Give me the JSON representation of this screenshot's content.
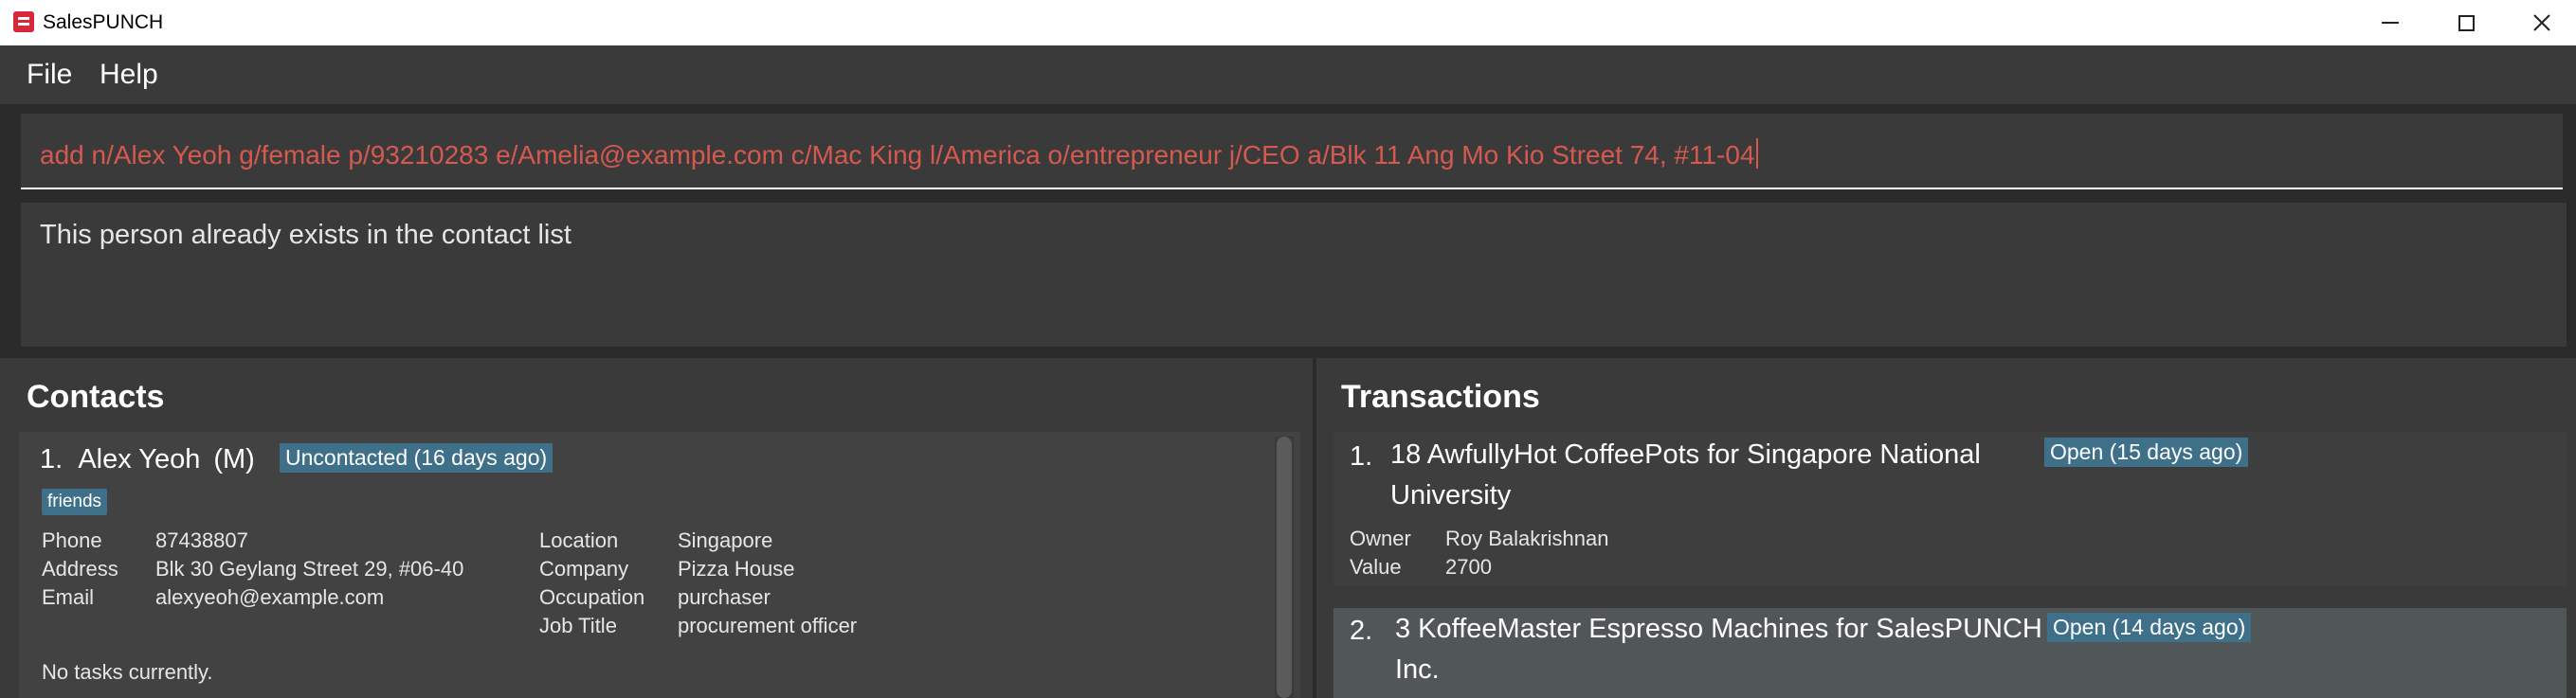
{
  "window": {
    "title": "SalesPUNCH",
    "controls": [
      "minimize",
      "maximize",
      "close"
    ]
  },
  "menu": {
    "file": "File",
    "help": "Help"
  },
  "command": {
    "value": "add n/Alex Yeoh g/female p/93210283 e/Amelia@example.com c/Mac King l/America o/entrepreneur j/CEO a/Blk 11 Ang Mo Kio Street 74, #11-04"
  },
  "result": {
    "message": "This person already exists in the contact list"
  },
  "contacts": {
    "title": "Contacts",
    "items": [
      {
        "index": "1.",
        "name": "Alex Yeoh",
        "gender": "(M)",
        "status": "Uncontacted (16 days ago)",
        "tag": "friends",
        "left_fields": [
          {
            "label": "Phone",
            "value": "87438807"
          },
          {
            "label": "Address",
            "value": "Blk 30 Geylang Street 29, #06-40"
          },
          {
            "label": "Email",
            "value": "alexyeoh@example.com"
          }
        ],
        "right_fields": [
          {
            "label": "Location",
            "value": "Singapore"
          },
          {
            "label": "Company",
            "value": "Pizza House"
          },
          {
            "label": "Occupation",
            "value": "purchaser"
          },
          {
            "label": "Job Title",
            "value": "procurement officer"
          }
        ],
        "tasks": "No tasks currently."
      }
    ]
  },
  "transactions": {
    "title": "Transactions",
    "items": [
      {
        "index": "1.",
        "title_line1": "18 AwfullyHot CoffeePots for Singapore National",
        "title_line2": "University",
        "status": "Open (15 days ago)",
        "owner_label": "Owner",
        "owner": "Roy Balakrishnan",
        "value_label": "Value",
        "value": "2700"
      },
      {
        "index": "2.",
        "title_line1": "3 KoffeeMaster Espresso Machines for SalesPUNCH",
        "title_line2": "Inc.",
        "status": "Open (14 days ago)"
      }
    ]
  },
  "colors": {
    "accent_badge": "#3f7089",
    "command_text": "#d5594f",
    "background": "#2b2b2b",
    "panel": "#3a3a3a",
    "selected_card": "#515658"
  }
}
